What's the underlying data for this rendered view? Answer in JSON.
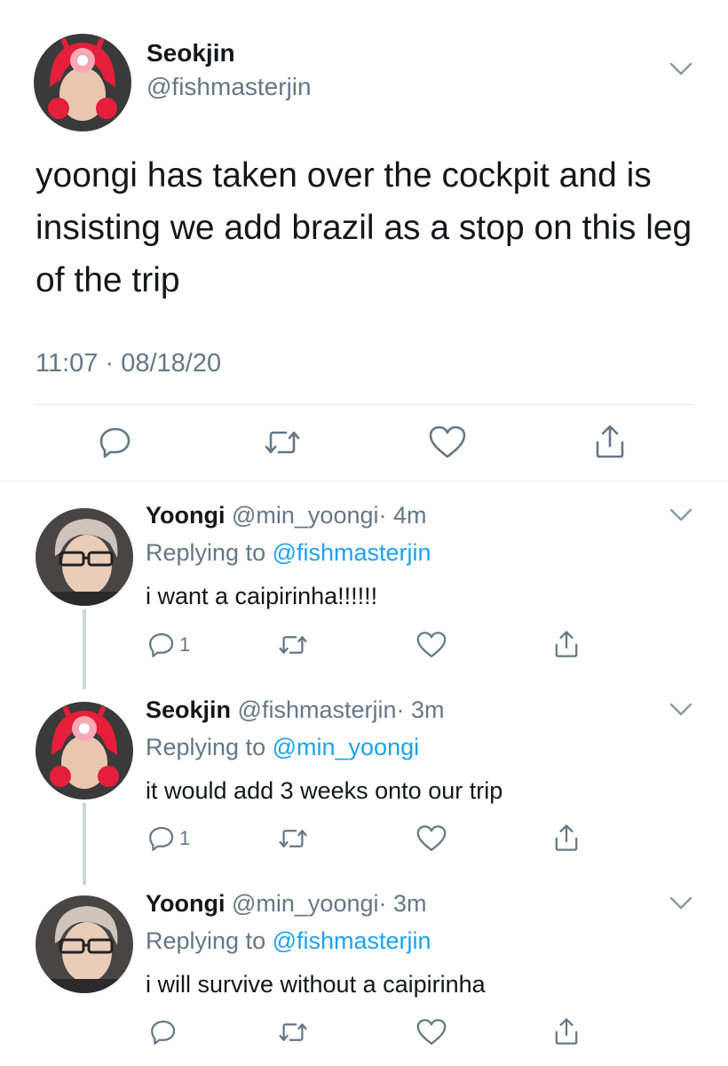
{
  "main_tweet": {
    "author_name": "Seokjin",
    "author_handle": "@fishmasterjin",
    "text": "yoongi has taken over the cockpit and is insisting we add brazil as a stop on this leg of the trip",
    "timestamp": "11:07 · 08/18/20"
  },
  "replies": [
    {
      "author_name": "Yoongi",
      "author_handle": "@min_yoongi",
      "time": "· 4m",
      "replying_label": "Replying to",
      "replying_to": "@fishmasterjin",
      "text": "i want a caipirinha!!!!!!",
      "reply_count": "1"
    },
    {
      "author_name": "Seokjin",
      "author_handle": "@fishmasterjin",
      "time": "· 3m",
      "replying_label": "Replying to",
      "replying_to": "@min_yoongi",
      "text": "it would add 3 weeks onto our trip",
      "reply_count": "1"
    },
    {
      "author_name": "Yoongi",
      "author_handle": "@min_yoongi",
      "time": "· 3m",
      "replying_label": "Replying to",
      "replying_to": "@fishmasterjin",
      "text": "i will survive without a caipirinha",
      "reply_count": ""
    }
  ],
  "colors": {
    "link": "#1da1f2",
    "muted": "#657786",
    "divider": "#e6ecf0",
    "thread_line": "#ccd6dd"
  },
  "icons": [
    "chevron-down-icon",
    "reply-icon",
    "retweet-icon",
    "like-icon",
    "share-icon"
  ]
}
